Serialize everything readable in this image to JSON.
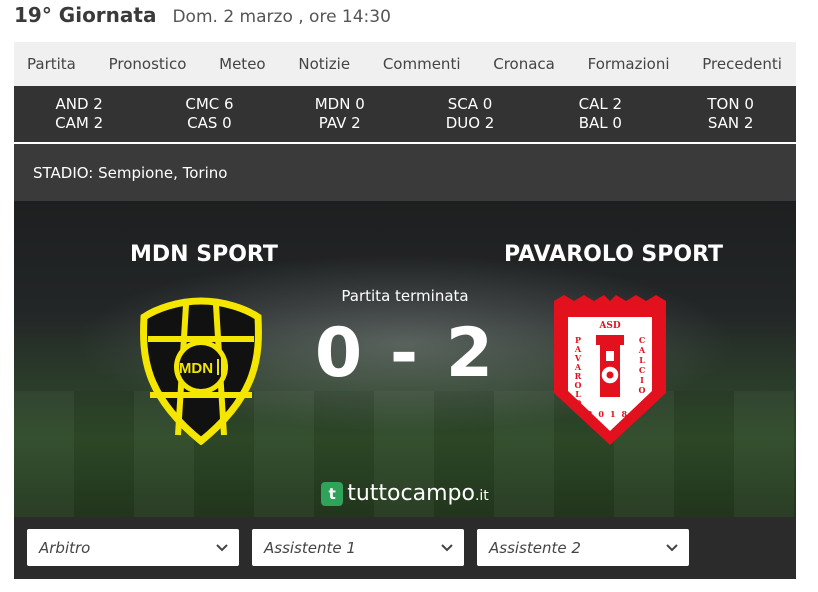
{
  "header": {
    "round": "19° Giornata",
    "datetime": "Dom. 2 marzo , ore 14:30"
  },
  "tabs": [
    "Partita",
    "Pronostico",
    "Meteo",
    "Notizie",
    "Commenti",
    "Cronaca",
    "Formazioni",
    "Precedenti"
  ],
  "scoreboard": [
    {
      "home": "AND 2",
      "away": "CAM 2"
    },
    {
      "home": "CMC 6",
      "away": "CAS 0"
    },
    {
      "home": "MDN 0",
      "away": "PAV 2"
    },
    {
      "home": "SCA 0",
      "away": "DUO 2"
    },
    {
      "home": "CAL 2",
      "away": "BAL 0"
    },
    {
      "home": "TON 0",
      "away": "SAN 2"
    }
  ],
  "venue": "STADIO: Sempione, Torino",
  "match": {
    "home_team": "MDN SPORT",
    "away_team": "PAVAROLO SPORT",
    "status": "Partita terminata",
    "score": "0 - 2",
    "home_crest_text": "MDN",
    "away_crest_top": "ASD",
    "away_crest_left": "PAVAROLO",
    "away_crest_right": "CALCIO",
    "away_crest_year": "2018"
  },
  "brand": {
    "icon_letter": "t",
    "name": "tuttocampo",
    "tld": ".it"
  },
  "officials": {
    "referee": "Arbitro",
    "assistant1": "Assistente 1",
    "assistant2": "Assistente 2"
  },
  "colors": {
    "crest_yellow": "#f5e600",
    "crest_red": "#e3101e",
    "brand_green": "#2fa35a",
    "scoreboard_bg": "#333333"
  }
}
